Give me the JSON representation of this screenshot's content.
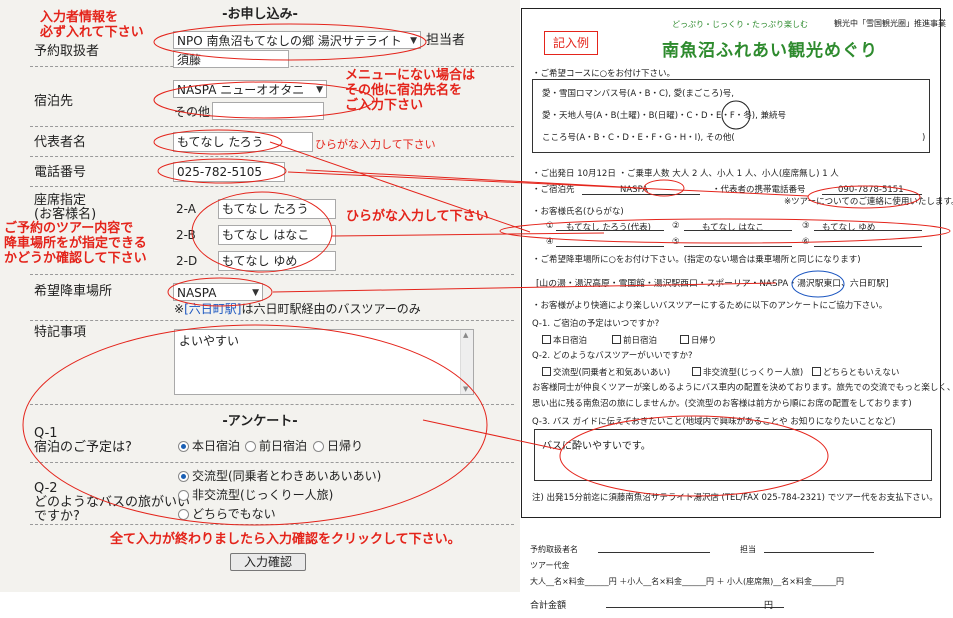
{
  "form": {
    "title": "-お申し込み-",
    "agency": {
      "label": "予約取扱者",
      "selected": "NPO  南魚沼もてなしの郷  湯沢サテライト",
      "staff_label": "担当者",
      "staff_value": "須藤"
    },
    "lodging": {
      "label": "宿泊先",
      "selected": "NASPA  ニューオオタニ",
      "other_label": "その他"
    },
    "rep": {
      "label": "代表者名",
      "value": "もてなし  たろう"
    },
    "phone": {
      "label": "電話番号",
      "value": "025-782-5105"
    },
    "seats": {
      "label1": "座席指定",
      "label2": "(お客様名)",
      "rows": [
        {
          "seat": "2-A",
          "name": "もてなし  たろう"
        },
        {
          "seat": "2-B",
          "name": "もてなし  はなこ"
        },
        {
          "seat": "2-D",
          "name": "もてなし  ゆめ"
        }
      ]
    },
    "dropoff": {
      "label": "希望降車場所",
      "selected": "NASPA",
      "note_pre": "※",
      "note_bracket": "[六日町駅]",
      "note_post": "は六日町駅経由のバスツアーのみ"
    },
    "remarks": {
      "label": "特記事項",
      "value": "よいやすい"
    },
    "survey": {
      "title": "-アンケート-",
      "q1": {
        "label1": "Q-1",
        "label2": "宿泊のご予定は?",
        "options": [
          "本日宿泊",
          "前日宿泊",
          "日帰り"
        ],
        "selected": 0
      },
      "q2": {
        "label1": "Q-2",
        "label2": "どのようなバスの旅がいい",
        "label3": "ですか?",
        "options": [
          "交流型(同乗者とわきあいあいあい)",
          "非交流型(じっくりー人旅)",
          "どちらでもない"
        ],
        "selected": 0
      }
    },
    "submit_label": "入力確認"
  },
  "annotations": {
    "a1": "入力者情報を",
    "a2": "必ず入れて下さい",
    "b1": "メニューにない場合は",
    "b2": "その他に宿泊先名を",
    "b3": "ご入力下さい",
    "c": "ひらがな入力して下さい",
    "d": "ひらがな入力して下さい",
    "e1": "ご予約のツアー内容で",
    "e2": "降車場所をが指定できる",
    "e3": "かどうか確認して下さい",
    "f": "全て入力が終わりましたら入力確認をクリックして下さい。",
    "color": "#e4241b"
  },
  "sheet": {
    "kinyu": "記入例",
    "catch": "どっぷり・じっくり・たっぷり楽しむ",
    "sponsor": "観光中「雪国観光圏」推進事業",
    "brand": "南魚沼ふれあい観光めぐり",
    "course_intro": "・ご希望コースに○をお付け下さい。",
    "course1": "愛・雪国ロマンバス号(A・B・C), 愛(まごころ)号,",
    "course2": "愛・天地人号(A・B(土曜)・B(日曜)・C・D・E・F・冬), 兼続号",
    "course3": "こころ号(A・B・C・D・E・F・G・H・I), その他(",
    "course3_end": ")",
    "date_line": "・ご出発日  10月12日  ・ご乗車人数  大人 2 人、小人 1 人、小人(座席無し) 1 人",
    "lodging_label": "・ご宿泊先",
    "lodging_value": "NASPA",
    "rep_label": "・代表者の携帯電話番号",
    "rep_phone": "090-7878-5151",
    "tour_note": "※ツアーについてのご連絡に使用いたします。",
    "names_label": "・お客様氏名(ひらがな)",
    "n1_no": "①",
    "n1": "もてなし たろう(代表)",
    "n2_no": "②",
    "n2": "もてなし はなこ",
    "n3_no": "③",
    "n3": "もてなし ゆめ",
    "n4_no": "④",
    "n5_no": "⑤",
    "n6_no": "⑥",
    "dropoff_intro": "・ご希望降車場所に○をお付け下さい。(指定のない場合は乗車場所と同じになります)",
    "dropoff_list": "[山の湯・湯沢高原・雪国館・湯沢駅西口・スポーリア・NASPA・湯沢駅東口、六日町駅]",
    "survey_intro": "・お客様がより快適により楽しいバスツアーにするために以下のアンケートにご協力下さい。",
    "sq1": "Q-1. ご宿泊の予定はいつですか?",
    "sq1_opts": [
      "本日宿泊",
      "前日宿泊",
      "日帰り"
    ],
    "sq2": "Q-2. どのようなバスツアーがいいですか?",
    "sq2_opts": [
      "交流型(同乗者と和気あいあい)",
      "非交流型(じっくりー人旅)",
      "どちらともいえない"
    ],
    "sq2_note1": "お客様同士が仲良くツアーが楽しめるようにバス車内の配置を決めております。旅先での交流でもっと楽しく、",
    "sq2_note2": "思い出に残る南魚沼の旅にしませんか。(交流型のお客様は前方から順にお席の配置をしております)",
    "sq3": "Q-3. バス ガイドに伝えておきたいこと(地域内で興味があることや お知りになりたいことなど)",
    "sq3_answer": "バスに酔いやすいです。",
    "footer": "注) 出発15分前迄に須藤南魚沼サテライト湯沢店 (TEL/FAX  025-784-2321) でツアー代をお支払下さい。"
  },
  "below": {
    "agent": "予約取扱者名",
    "staff": "担当",
    "price_label": "ツアー代金",
    "price_line": "大人__名×料金______円  ＋小人__名×料金______円  ＋ 小人(座席無)__名×料金______円",
    "total_label": "合計金額",
    "total_unit": "円"
  }
}
